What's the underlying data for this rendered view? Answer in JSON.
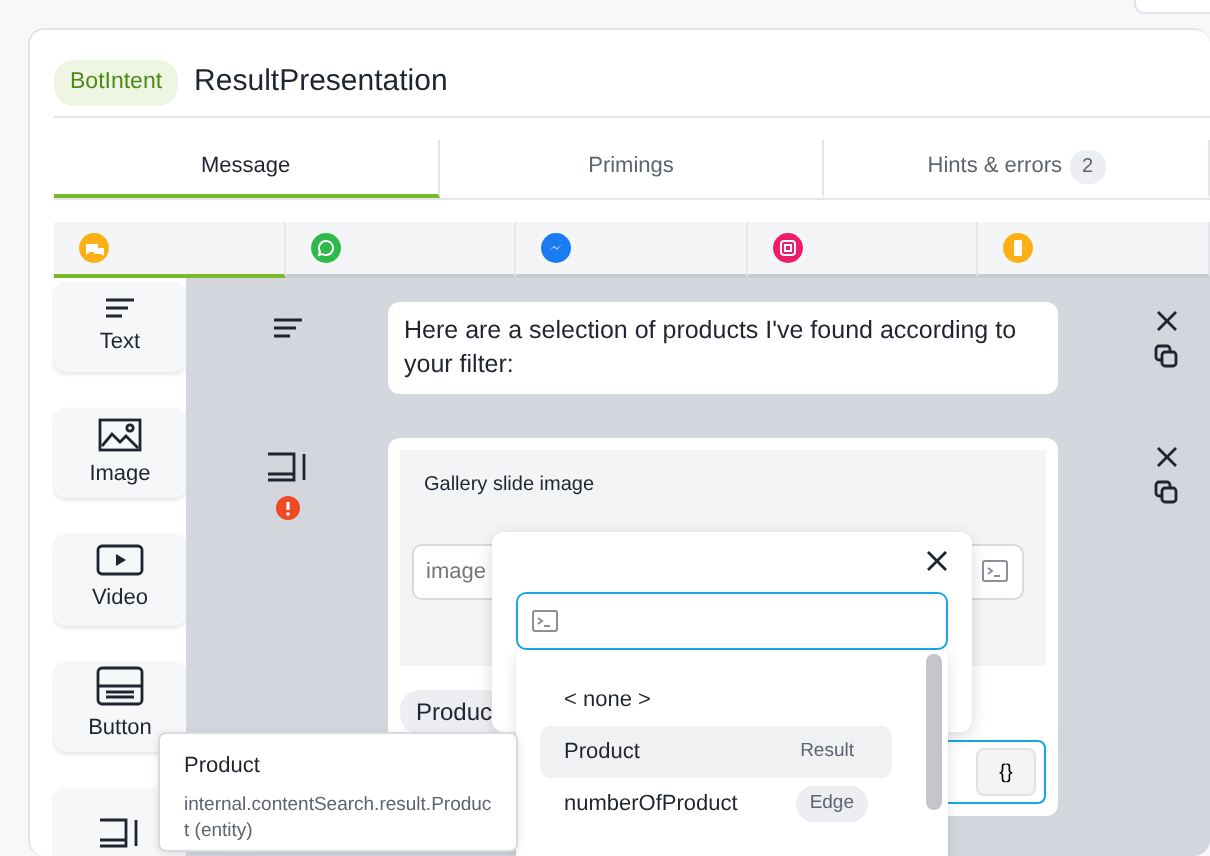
{
  "header": {
    "badge": "BotIntent",
    "title": "ResultPresentation"
  },
  "tabs": [
    {
      "label": "Message",
      "selected": true
    },
    {
      "label": "Primings",
      "selected": false
    },
    {
      "label": "Hints & errors",
      "count": "2",
      "selected": false
    }
  ],
  "channels": [
    {
      "kind": "chat",
      "color": "#fbb116",
      "selected": true
    },
    {
      "kind": "whatsapp",
      "color": "#2fb84a",
      "selected": false
    },
    {
      "kind": "messenger",
      "color": "#1a7cf2",
      "selected": false
    },
    {
      "kind": "instagram",
      "color": "#ee1d6b",
      "selected": false
    },
    {
      "kind": "phone",
      "color": "#fbb116",
      "selected": false
    }
  ],
  "palette": [
    {
      "kind": "text",
      "label": "Text"
    },
    {
      "kind": "image",
      "label": "Image"
    },
    {
      "kind": "video",
      "label": "Video"
    },
    {
      "kind": "button",
      "label": "Button"
    },
    {
      "kind": "gallery"
    }
  ],
  "messages": [
    {
      "kind": "text",
      "text": "Here are a selection of products I've found according to your filter:"
    },
    {
      "kind": "gallery",
      "has_error": true,
      "section_label": "Gallery slide image",
      "image_placeholder": "image",
      "chip": "Produc",
      "brace_button": "{}"
    }
  ],
  "picker": {
    "items": [
      {
        "label": "< none >",
        "selected": false
      },
      {
        "label": "Product",
        "tag": "Result",
        "selected": true
      },
      {
        "label": "numberOfProduct",
        "tag": "Edge",
        "selected": false
      }
    ]
  },
  "tooltip": {
    "title": "Product",
    "detail": "internal.contentSearch.result.Product (entity)"
  }
}
